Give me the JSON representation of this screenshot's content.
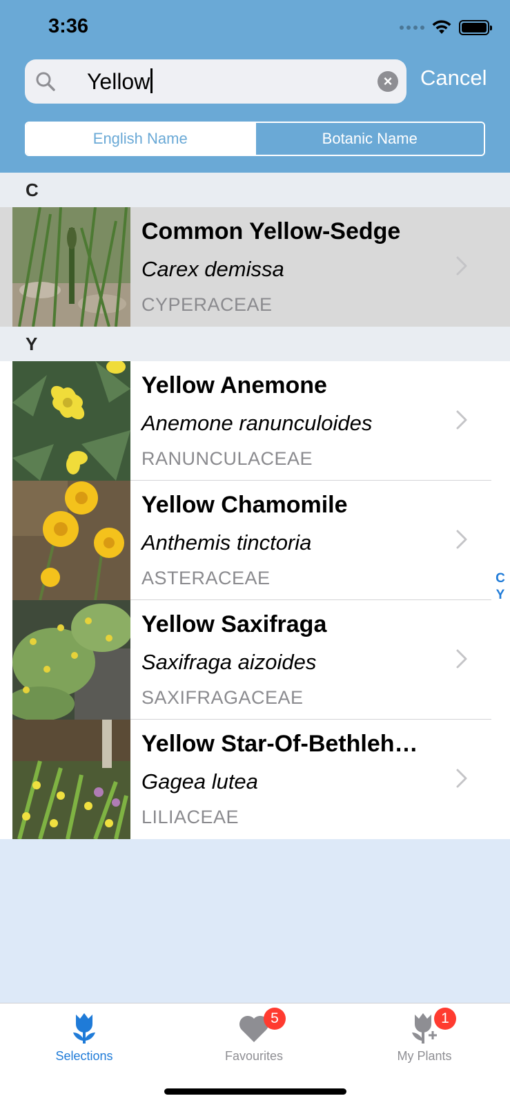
{
  "status_bar": {
    "time": "3:36"
  },
  "search": {
    "value": "Yellow",
    "cancel_label": "Cancel"
  },
  "segments": {
    "english": "English Name",
    "botanic": "Botanic Name",
    "selected": "Botanic Name"
  },
  "sections": [
    {
      "letter": "C",
      "rows": [
        {
          "title": "Common Yellow-Sedge",
          "botanic": "Carex demissa",
          "family": "CYPERACEAE",
          "highlighted": true
        }
      ]
    },
    {
      "letter": "Y",
      "rows": [
        {
          "title": "Yellow Anemone",
          "botanic": "Anemone ranunculoides",
          "family": "RANUNCULACEAE"
        },
        {
          "title": "Yellow Chamomile",
          "botanic": "Anthemis tinctoria",
          "family": "ASTERACEAE"
        },
        {
          "title": "Yellow Saxifraga",
          "botanic": "Saxifraga aizoides",
          "family": "SAXIFRAGACEAE"
        },
        {
          "title": "Yellow Star-Of-Bethleh…",
          "botanic": "Gagea lutea",
          "family": "LILIACEAE"
        }
      ]
    }
  ],
  "index_letters": [
    "C",
    "Y"
  ],
  "tabbar": {
    "items": [
      {
        "label": "Selections",
        "selected": true
      },
      {
        "label": "Favourites",
        "badge": "5"
      },
      {
        "label": "My Plants",
        "badge": "1"
      }
    ]
  },
  "colors": {
    "header": "#6aa9d6",
    "accent": "#1f7bd8",
    "badge": "#ff3b30"
  }
}
